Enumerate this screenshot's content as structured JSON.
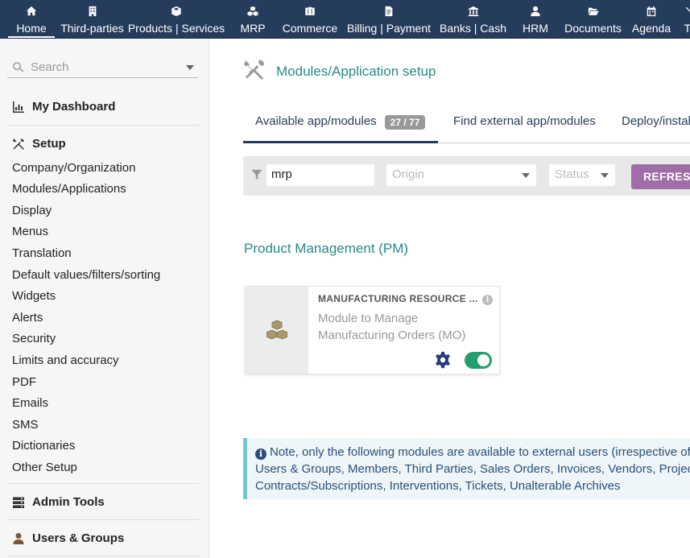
{
  "topnav": {
    "items": [
      {
        "label": "Home",
        "icon": "home-icon"
      },
      {
        "label": "Third-parties",
        "icon": "building-icon"
      },
      {
        "label": "Products | Services",
        "icon": "cube-icon"
      },
      {
        "label": "MRP",
        "icon": "cubes-icon"
      },
      {
        "label": "Commerce",
        "icon": "suitcase-icon"
      },
      {
        "label": "Billing | Payment",
        "icon": "invoice-icon"
      },
      {
        "label": "Banks | Cash",
        "icon": "bank-icon"
      },
      {
        "label": "HRM",
        "icon": "user-tie-icon"
      },
      {
        "label": "Documents",
        "icon": "folder-open-icon"
      },
      {
        "label": "Agenda",
        "icon": "calendar-icon"
      },
      {
        "label": "To",
        "icon": "tools-icon"
      }
    ]
  },
  "sidebar": {
    "search_placeholder": "Search",
    "dashboard_label": "My Dashboard",
    "setup_label": "Setup",
    "setup_items": [
      "Company/Organization",
      "Modules/Applications",
      "Display",
      "Menus",
      "Translation",
      "Default values/filters/sorting",
      "Widgets",
      "Alerts",
      "Security",
      "Limits and accuracy",
      "PDF",
      "Emails",
      "SMS",
      "Dictionaries",
      "Other Setup"
    ],
    "admin_tools_label": "Admin Tools",
    "users_groups_label": "Users & Groups"
  },
  "main": {
    "title": "Modules/Application setup",
    "tabs": [
      {
        "label": "Available app/modules",
        "badge": "27 / 77",
        "active": true
      },
      {
        "label": "Find external app/modules"
      },
      {
        "label": "Deploy/instal"
      }
    ],
    "filter": {
      "search_value": "mrp",
      "origin_placeholder": "Origin",
      "status_placeholder": "Status",
      "refresh_label": "REFRESH"
    },
    "group_title": "Product Management (PM)",
    "module_card": {
      "title": "MANUFACTURING RESOURCE ...",
      "description": "Module to Manage Manufacturing Orders (MO)",
      "enabled": true
    },
    "note": {
      "line1": "Note, only the following modules are available to external users (irrespective of t",
      "line2": "Users & Groups, Members, Third Parties, Sales Orders, Invoices, Vendors, Projects",
      "line3": "Contracts/Subscriptions, Interventions, Tickets, Unalterable Archives"
    }
  },
  "colors": {
    "topbar": "#263c5c",
    "accent_teal": "#2a8a8a",
    "refresh_button": "#a06ea6",
    "toggle_on": "#22a06b"
  }
}
